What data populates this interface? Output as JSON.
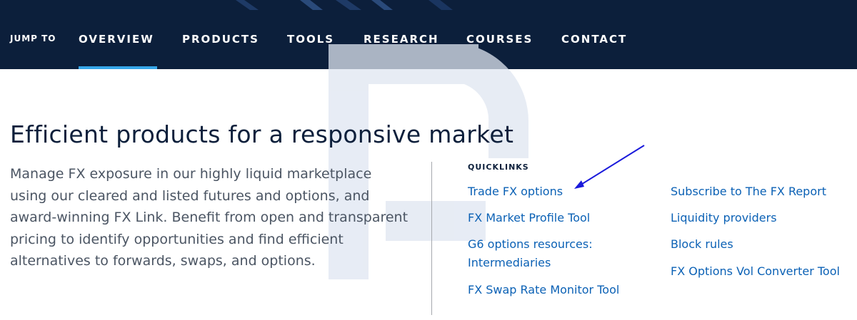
{
  "nav": {
    "jump_to": "JUMP TO",
    "items": [
      {
        "label": "OVERVIEW",
        "active": true
      },
      {
        "label": "PRODUCTS",
        "active": false
      },
      {
        "label": "TOOLS",
        "active": false
      },
      {
        "label": "RESEARCH",
        "active": false
      },
      {
        "label": "COURSES",
        "active": false
      },
      {
        "label": "CONTACT",
        "active": false
      }
    ],
    "background_color": "#0c1f3b",
    "active_underline_color": "#36a6e8"
  },
  "main": {
    "headline": "Efficient products for a responsive market",
    "description": "Manage FX exposure in our highly liquid marketplace using our cleared and listed futures and options, and award-winning FX Link. Benefit from open and transparent pricing to identify opportunities and find efficient alternatives to forwards, swaps, and options."
  },
  "quicklinks": {
    "heading": "QUICKLINKS",
    "left_column": [
      "Trade FX options",
      "FX Market Profile Tool",
      "G6 options resources:",
      "Intermediaries",
      "FX Swap Rate Monitor Tool"
    ],
    "right_column": [
      "Subscribe to The FX Report",
      "Liquidity providers",
      "Block rules",
      "FX Options Vol Converter Tool"
    ],
    "link_color": "#0b61b5"
  },
  "annotation": {
    "icon": "arrow-icon",
    "color": "#1a1adb"
  }
}
